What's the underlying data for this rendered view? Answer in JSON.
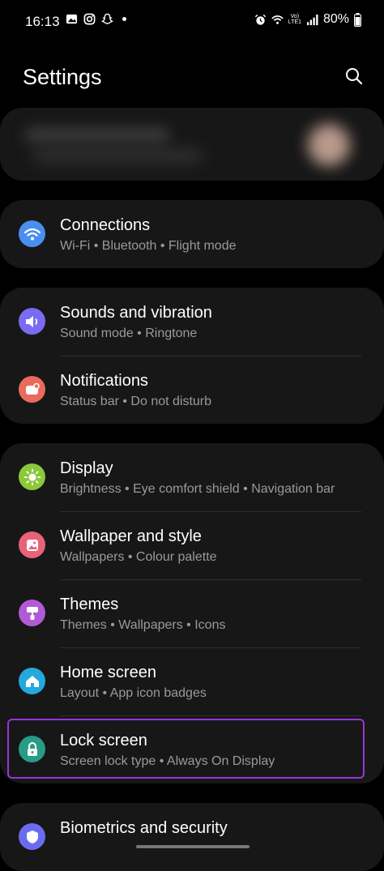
{
  "status_bar": {
    "time": "16:13",
    "battery": "80%",
    "lte_top": "Vo)",
    "lte_bottom": "LTE1"
  },
  "header": {
    "title": "Settings"
  },
  "groups": [
    {
      "items": [
        {
          "label": "Connections",
          "sub": "Wi-Fi  •  Bluetooth  •  Flight mode",
          "icon": "wifi-icon",
          "color": "#4a8ff0"
        }
      ]
    },
    {
      "items": [
        {
          "label": "Sounds and vibration",
          "sub": "Sound mode  •  Ringtone",
          "icon": "speaker-icon",
          "color": "#7a6cf0"
        },
        {
          "label": "Notifications",
          "sub": "Status bar  •  Do not disturb",
          "icon": "notification-icon",
          "color": "#ea6b5b"
        }
      ]
    },
    {
      "items": [
        {
          "label": "Display",
          "sub": "Brightness  •  Eye comfort shield  •  Navigation bar",
          "icon": "sun-icon",
          "color": "#8bc83a"
        },
        {
          "label": "Wallpaper and style",
          "sub": "Wallpapers  •  Colour palette",
          "icon": "image-icon",
          "color": "#e8627a"
        },
        {
          "label": "Themes",
          "sub": "Themes  •  Wallpapers  •  Icons",
          "icon": "brush-icon",
          "color": "#b25ad6"
        },
        {
          "label": "Home screen",
          "sub": "Layout  •  App icon badges",
          "icon": "home-icon",
          "color": "#25a8de"
        },
        {
          "label": "Lock screen",
          "sub": "Screen lock type  •  Always On Display",
          "icon": "lock-icon",
          "color": "#279c86"
        }
      ]
    },
    {
      "items": [
        {
          "label": "Biometrics and security",
          "sub": "",
          "icon": "shield-icon",
          "color": "#6a6cf0"
        }
      ]
    }
  ]
}
